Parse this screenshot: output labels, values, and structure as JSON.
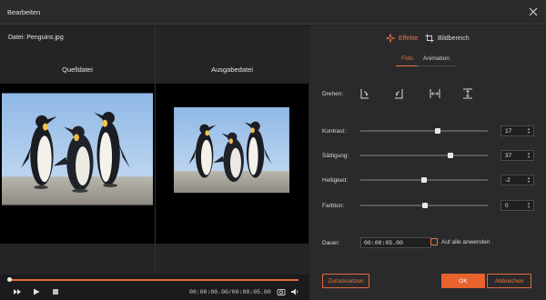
{
  "window": {
    "title": "Bearbeiten"
  },
  "file": {
    "label": "Datei: Penguins.jpg"
  },
  "preview": {
    "source_title": "Quelldatei",
    "output_title": "Ausgabedatei"
  },
  "playback": {
    "timecode": "00:00:00.00/00:00:05.00",
    "progress": 0.0
  },
  "tabs": {
    "effects": "Effekte",
    "crop": "Bildbereich"
  },
  "subtabs": {
    "photo": "Foto",
    "animation": "Animation"
  },
  "rotate": {
    "label": "Drehen:"
  },
  "adjustments": [
    {
      "label": "Kontrast:",
      "value": "17",
      "fraction": 0.61
    },
    {
      "label": "Sättigung:",
      "value": "37",
      "fraction": 0.71
    },
    {
      "label": "Helligkeit:",
      "value": "-2",
      "fraction": 0.5
    },
    {
      "label": "Farbton:",
      "value": "0",
      "fraction": 0.51
    }
  ],
  "duration": {
    "label": "Dauer:",
    "value": "00:00:05.00"
  },
  "apply_all": {
    "label": "Auf alle anwenden",
    "checked": false
  },
  "buttons": {
    "reset": "Zurücksetzen",
    "ok": "OK",
    "cancel": "Abbrechen"
  },
  "colors": {
    "accent": "#e8622f",
    "background": "#1e1e1e",
    "panel": "#2a2a2c"
  }
}
